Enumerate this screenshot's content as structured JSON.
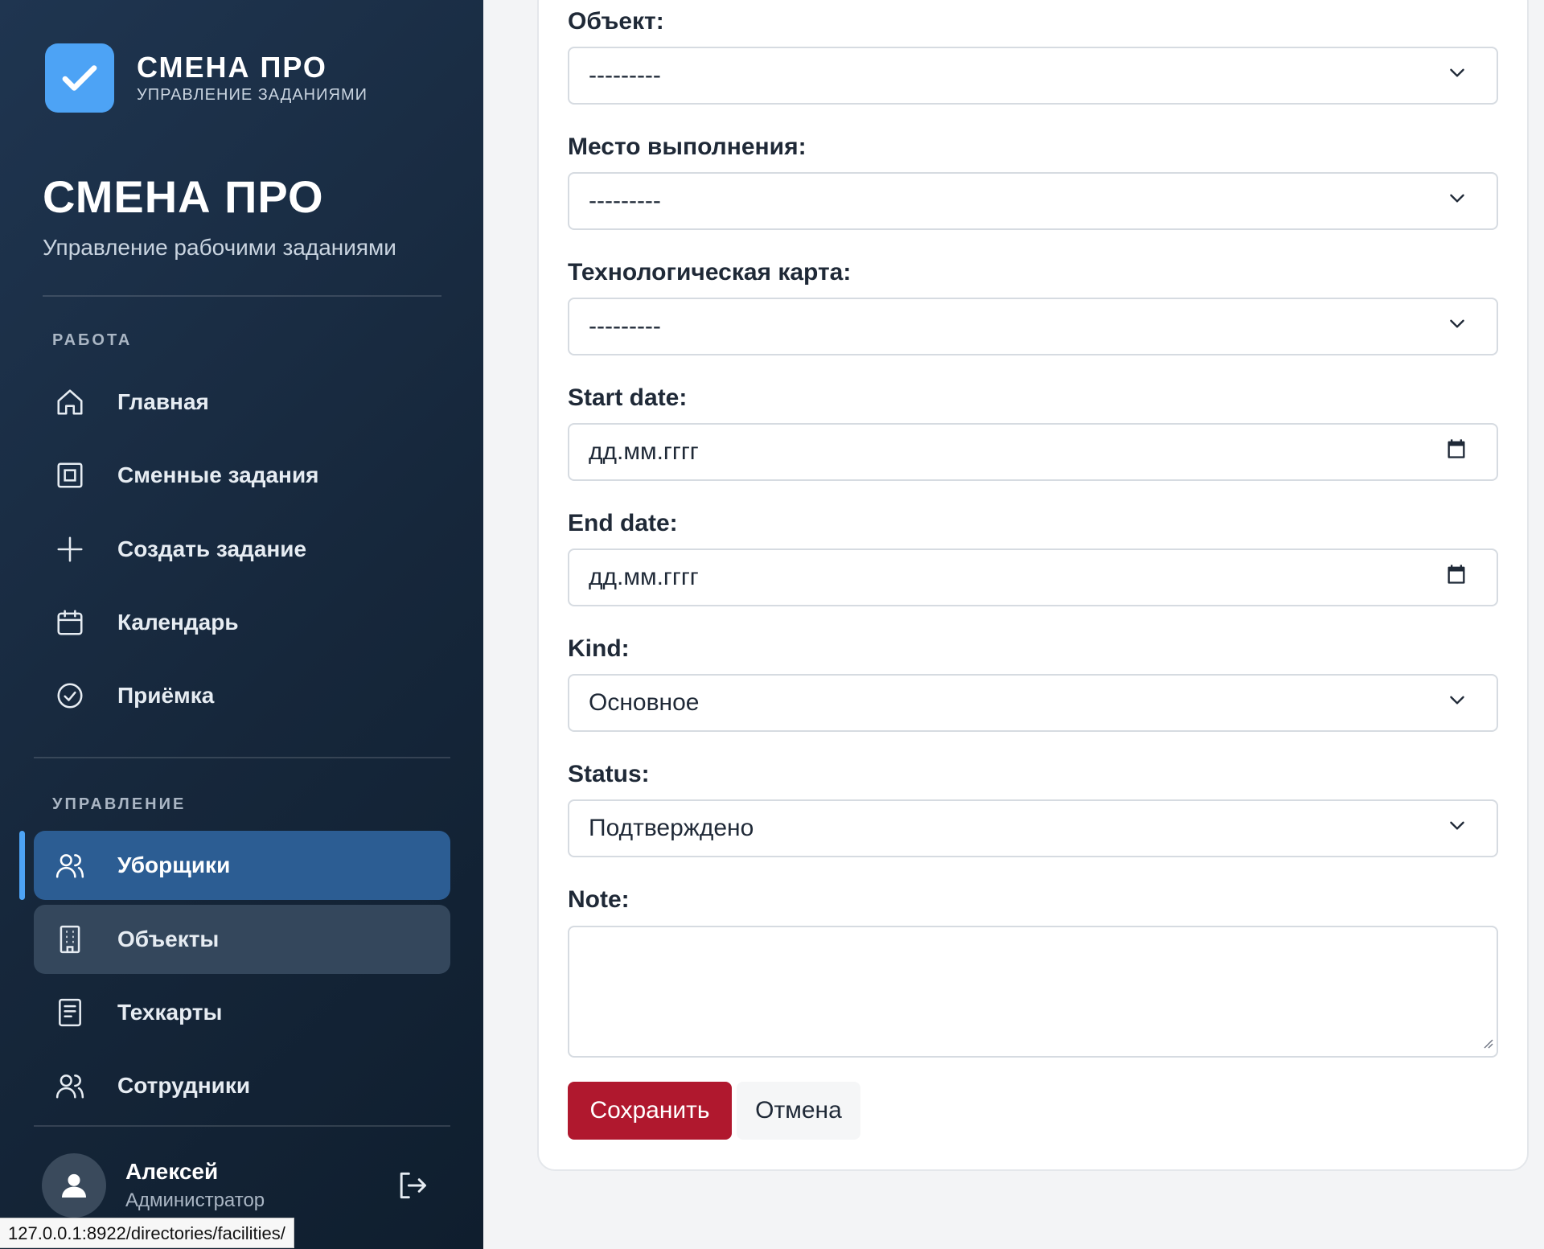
{
  "sidebar": {
    "brand_name": "СМЕНА ПРО",
    "brand_sub": "УПРАВЛЕНИЕ ЗАДАНИЯМИ",
    "title": "СМЕНА ПРО",
    "subtitle": "Управление рабочими заданиями",
    "section_work": "РАБОТА",
    "section_manage": "УПРАВЛЕНИЕ",
    "work_items": [
      {
        "label": "Главная",
        "icon": "home-icon"
      },
      {
        "label": "Сменные задания",
        "icon": "square-icon"
      },
      {
        "label": "Создать задание",
        "icon": "plus-icon"
      },
      {
        "label": "Календарь",
        "icon": "calendar-icon"
      },
      {
        "label": "Приёмка",
        "icon": "check-circle-icon"
      }
    ],
    "manage_items": [
      {
        "label": "Уборщики",
        "icon": "users-icon",
        "state": "active"
      },
      {
        "label": "Объекты",
        "icon": "building-icon",
        "state": "hover"
      },
      {
        "label": "Техкарты",
        "icon": "document-icon"
      },
      {
        "label": "Сотрудники",
        "icon": "users-icon"
      }
    ],
    "user": {
      "name": "Алексей",
      "role": "Администратор"
    },
    "accent": "#4da3f5",
    "active_bg": "#2c5d93"
  },
  "status_bar": {
    "url": "127.0.0.1:8922/directories/facilities/"
  },
  "form": {
    "object_label": "Объект:",
    "object_value": "---------",
    "place_label": "Место выполнения:",
    "place_value": "---------",
    "techcard_label": "Технологическая карта:",
    "techcard_value": "---------",
    "start_label": "Start date:",
    "start_placeholder": "дд.мм.гггг",
    "end_label": "End date:",
    "end_placeholder": "дд.мм.гггг",
    "kind_label": "Kind:",
    "kind_value": "Основное",
    "status_label": "Status:",
    "status_value": "Подтверждено",
    "note_label": "Note:",
    "note_value": "",
    "save_label": "Сохранить",
    "cancel_label": "Отмена",
    "save_color": "#b0182e"
  }
}
